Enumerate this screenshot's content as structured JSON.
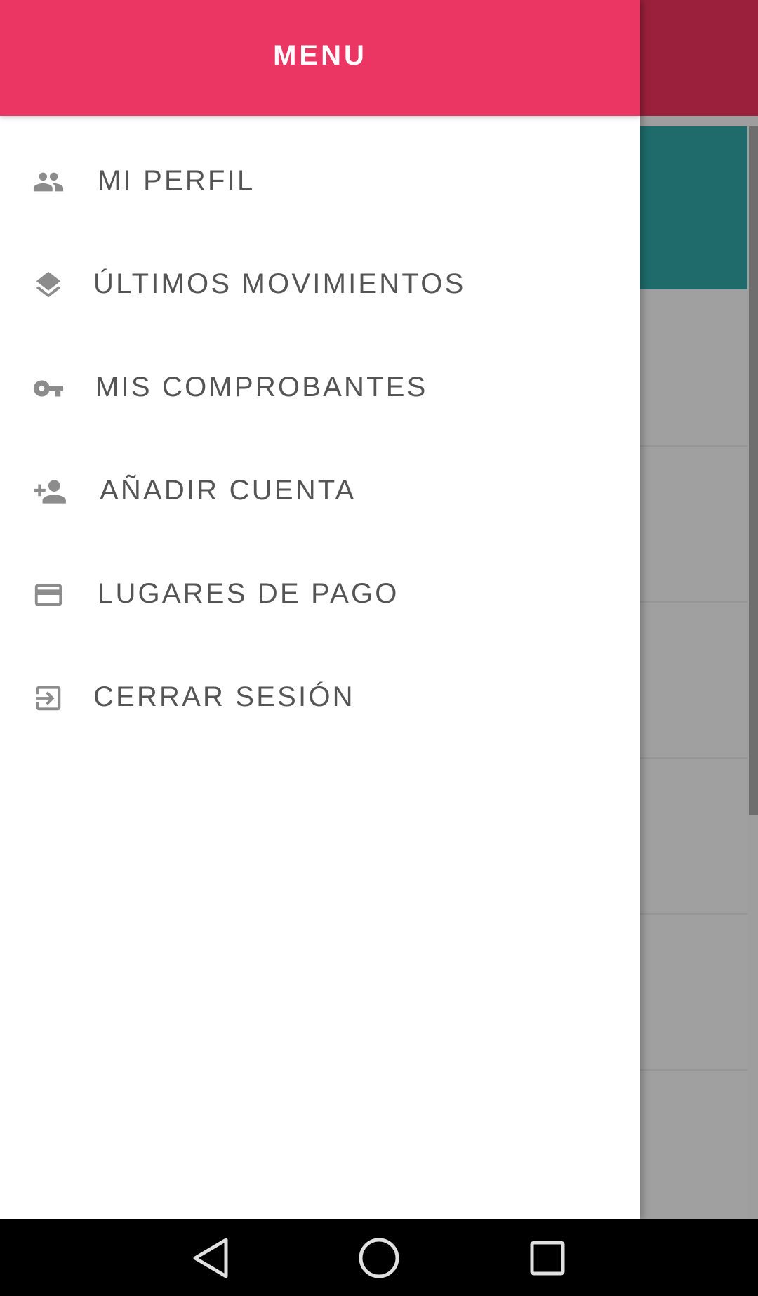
{
  "drawer": {
    "title": "MENU",
    "items": [
      {
        "label": "MI PERFIL",
        "icon": "people-icon"
      },
      {
        "label": "ÚLTIMOS MOVIMIENTOS",
        "icon": "layers-icon"
      },
      {
        "label": "MIS COMPROBANTES",
        "icon": "key-icon"
      },
      {
        "label": "AÑADIR CUENTA",
        "icon": "person-add-icon"
      },
      {
        "label": "LUGARES DE PAGO",
        "icon": "credit-card-icon"
      },
      {
        "label": "CERRAR SESIÓN",
        "icon": "exit-to-app-icon"
      }
    ]
  },
  "colors": {
    "header": "#eb3562",
    "background_appbar": "#9a203c",
    "background_card": "#1f6b6b",
    "icon": "#8c8c8c",
    "label": "#555555"
  },
  "navigation_bar": {
    "buttons": [
      "back-icon",
      "home-icon",
      "recents-icon"
    ]
  }
}
